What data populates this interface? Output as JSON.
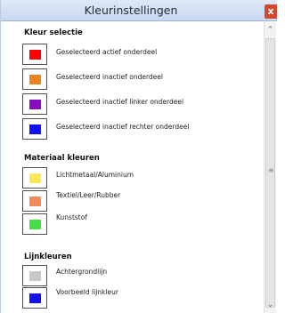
{
  "window": {
    "title": "Kleurinstellingen",
    "close_label": "x"
  },
  "sections": {
    "kleur_selectie": {
      "title": "Kleur selectie",
      "items": [
        {
          "label": "Geselecteerd actief onderdeel",
          "color": "#ff0000"
        },
        {
          "label": "Geselecteerd inactief onderdeel",
          "color": "#e8831e"
        },
        {
          "label": "Geselecteerd inactief linker onderdeel",
          "color": "#8a0cc2"
        },
        {
          "label": "Geselecteerd inactief rechter onderdeel",
          "color": "#1010f0"
        }
      ]
    },
    "materiaal_kleuren": {
      "title": "Materiaal kleuren",
      "items": [
        {
          "label": "Lichtmetaal/Aluminium",
          "color": "#fbe659"
        },
        {
          "label": "Textiel/Leer/Rubber",
          "color": "#f58a5c"
        },
        {
          "label": "Kunststof",
          "color": "#46dd46"
        }
      ]
    },
    "lijnkleuren": {
      "title": "Lijnkleuren",
      "items": [
        {
          "label": "Achtergrondlijn",
          "color": "#c8c8c8"
        },
        {
          "label": "Voorbeeld lijnkleur",
          "color": "#1010f0"
        }
      ]
    }
  },
  "scrollbar": {
    "up_icon": "chevron-up-icon",
    "down_icon": "chevron-down-icon"
  }
}
